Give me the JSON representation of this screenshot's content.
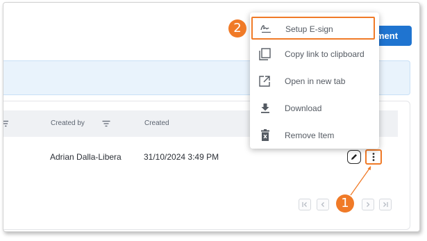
{
  "toolbar": {
    "add_document_label": "ment"
  },
  "table": {
    "columns": [
      {
        "label": "Created by",
        "filter_icon": "filter-icon"
      },
      {
        "label": "Created"
      }
    ],
    "rows": [
      {
        "created_by": "Adrian Dalla-Libera",
        "created": "31/10/2024 3:49 PM"
      }
    ]
  },
  "row_actions": {
    "edit_icon": "pencil-icon",
    "more_icon": "more-vertical-icon"
  },
  "context_menu": {
    "items": [
      {
        "label": "Setup E-sign",
        "icon": "signature-icon",
        "highlighted": true
      },
      {
        "label": "Copy link to clipboard",
        "icon": "copy-icon"
      },
      {
        "label": "Open in new tab",
        "icon": "open-external-icon"
      },
      {
        "label": "Download",
        "icon": "download-icon"
      },
      {
        "label": "Remove Item",
        "icon": "trash-icon"
      }
    ]
  },
  "pagination": {
    "buttons": [
      "first-page-icon",
      "prev-page-icon",
      "next-page-icon",
      "last-page-icon"
    ]
  },
  "callouts": {
    "step1": "1",
    "step2": "2"
  },
  "colors": {
    "callout": "#f07a27",
    "primary": "#1f74d0",
    "banner": "#e9f3fc"
  }
}
